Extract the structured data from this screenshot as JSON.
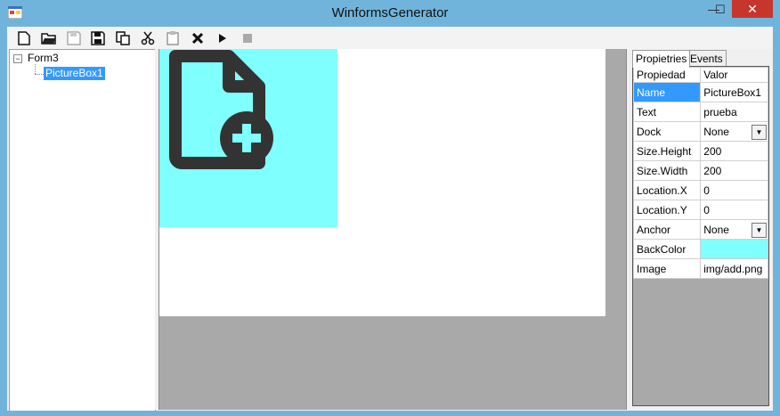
{
  "window": {
    "title": "WinformsGenerator",
    "close_glyph": "✕",
    "minimize_glyph": "—",
    "maximize_glyph": "☐"
  },
  "toolbar": {
    "buttons": [
      {
        "name": "new-icon",
        "glyph": "🗋"
      },
      {
        "name": "open-icon",
        "glyph": "📂"
      },
      {
        "name": "save-icon",
        "glyph": "💾"
      },
      {
        "name": "save-as-icon",
        "glyph": "💾"
      },
      {
        "name": "copy-icon",
        "glyph": "⎘"
      },
      {
        "name": "cut-icon",
        "glyph": "✂"
      },
      {
        "name": "paste-icon",
        "glyph": "📋"
      },
      {
        "name": "delete-icon",
        "glyph": "✖"
      },
      {
        "name": "run-icon",
        "glyph": "▶"
      },
      {
        "name": "stop-icon",
        "glyph": "■"
      }
    ]
  },
  "tree": {
    "expander": "−",
    "root": "Form3",
    "child": "PictureBox1"
  },
  "properties": {
    "tabs": [
      "Propietries",
      "Events"
    ],
    "headers": {
      "key": "Propiedad",
      "value": "Valor"
    },
    "rows": [
      {
        "key": "Name",
        "value": "PictureBox1"
      },
      {
        "key": "Text",
        "value": "prueba"
      },
      {
        "key": "Dock",
        "value": "None"
      },
      {
        "key": "Size.Height",
        "value": "200"
      },
      {
        "key": "Size.Width",
        "value": "200"
      },
      {
        "key": "Location.X",
        "value": "0"
      },
      {
        "key": "Location.Y",
        "value": "0"
      },
      {
        "key": "Anchor",
        "value": "None"
      },
      {
        "key": "BackColor",
        "value": ""
      },
      {
        "key": "Image",
        "value": "img/add.png"
      }
    ]
  },
  "colors": {
    "backcolor_swatch": "#80ffff",
    "selection": "#3399ff",
    "designer_bg": "#a9a9a9",
    "title_bar": "#70b4dc",
    "close_button": "#c7362d"
  }
}
